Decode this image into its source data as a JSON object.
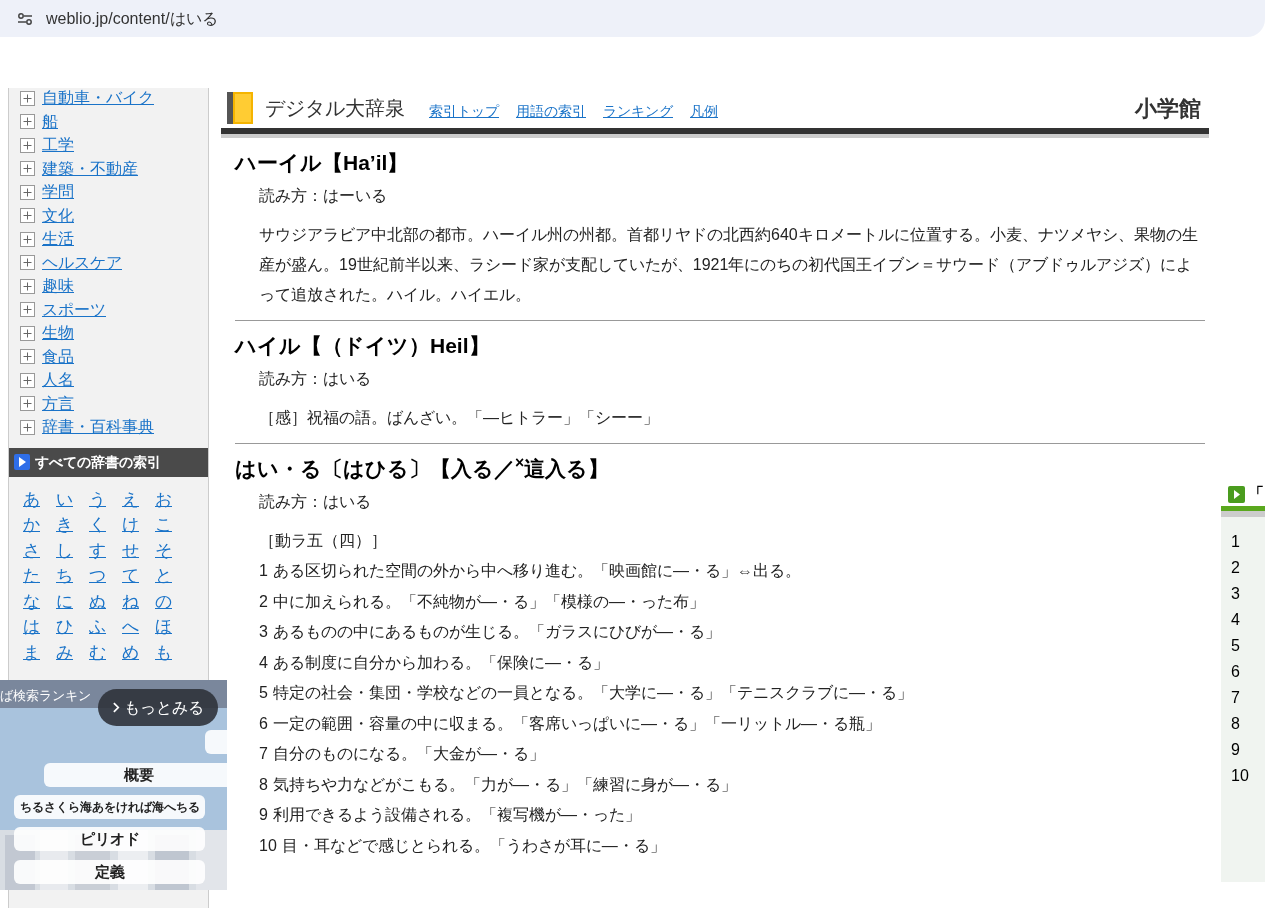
{
  "address_bar": {
    "url": "weblio.jp/content/はいる"
  },
  "sidebar": {
    "categories": [
      {
        "label": "自動車・バイク",
        "expanded": false
      },
      {
        "label": "船",
        "expanded": false
      },
      {
        "label": "工学",
        "expanded": false
      },
      {
        "label": "建築・不動産",
        "expanded": false
      },
      {
        "label": "学問",
        "expanded": false
      },
      {
        "label": "文化",
        "expanded": false
      },
      {
        "label": "生活",
        "expanded": false
      },
      {
        "label": "ヘルスケア",
        "expanded": false
      },
      {
        "label": "趣味",
        "expanded": false
      },
      {
        "label": "スポーツ",
        "expanded": false
      },
      {
        "label": "生物",
        "expanded": false
      },
      {
        "label": "食品",
        "expanded": false
      },
      {
        "label": "人名",
        "expanded": false
      },
      {
        "label": "方言",
        "expanded": false
      },
      {
        "label": "辞書・百科事典",
        "expanded": false
      }
    ],
    "index_title": "すべての辞書の索引",
    "kana": [
      [
        "あ",
        "い",
        "う",
        "え",
        "お"
      ],
      [
        "か",
        "き",
        "く",
        "け",
        "こ"
      ],
      [
        "さ",
        "し",
        "す",
        "せ",
        "そ"
      ],
      [
        "た",
        "ち",
        "つ",
        "て",
        "と"
      ],
      [
        "な",
        "に",
        "ぬ",
        "ね",
        "の"
      ],
      [
        "は",
        "ひ",
        "ふ",
        "へ",
        "ほ"
      ],
      [
        "ま",
        "み",
        "む",
        "め",
        "も"
      ]
    ]
  },
  "video_overlay": {
    "title": "ば検索ランキン",
    "more_button": "もっとみる",
    "cards": [
      "概要",
      "ちるさくら海あをければ海へちる",
      "ピリオド",
      "定義"
    ]
  },
  "dictionary": {
    "name": "デジタル大辞泉",
    "links": [
      "索引トップ",
      "用語の索引",
      "ランキング",
      "凡例"
    ],
    "publisher": "小学館",
    "entries": [
      {
        "headword": "ハーイル【Ha’il】",
        "reading": "読み方：はーいる",
        "body": [
          "サウジアラビア中北部の都市。ハーイル州の州都。首都リヤドの北西約640キロメートルに位置する。小麦、ナツメヤシ、果物の生産が盛ん。19世紀前半以来、ラシード家が支配していたが、1921年にのちの初代国王イブン＝サウード（アブドゥルアジズ）によって追放された。ハイル。ハイエル。"
        ]
      },
      {
        "headword": "ハイル【（ドイツ）Heil】",
        "reading": "読み方：はいる",
        "body": [
          "［感］祝福の語。ばんざい。「―ヒトラー」「シーー」"
        ]
      },
      {
        "headword": "はい・る〔はひる〕【入る／$^{×}$這入る】",
        "reading": "読み方：はいる",
        "body": [
          "［動ラ五（四）］"
        ],
        "senses": [
          {
            "number": "1",
            "text": "ある区切られた空間の外から中へ移り進む。「映画館に―・る」⇔出る。"
          },
          {
            "number": "2",
            "text": "中に加えられる。「不純物が―・る」「模様の―・った布」"
          },
          {
            "number": "3",
            "text": "あるものの中にあるものが生じる。「ガラスにひびが―・る」"
          },
          {
            "number": "4",
            "text": "ある制度に自分から加わる。「保険に―・る」"
          },
          {
            "number": "5",
            "text": "特定の社会・集団・学校などの一員となる。「大学に―・る」「テニスクラブに―・る」"
          },
          {
            "number": "6",
            "text": "一定の範囲・容量の中に収まる。「客席いっぱいに―・る」「一リットル―・る瓶」"
          },
          {
            "number": "7",
            "text": "自分のものになる。「大金が―・る」"
          },
          {
            "number": "8",
            "text": "気持ちや力などがこもる。「力が―・る」「練習に身が―・る」"
          },
          {
            "number": "9",
            "text": "利用できるよう設備される。「複写機が―・った」"
          },
          {
            "number": "10",
            "text": "目・耳などで感じとられる。「うわさが耳に―・る」"
          }
        ]
      }
    ]
  },
  "ranking": {
    "title": "「",
    "ranks": [
      "1",
      "2",
      "3",
      "4",
      "5",
      "6",
      "7",
      "8",
      "9",
      "10"
    ]
  }
}
